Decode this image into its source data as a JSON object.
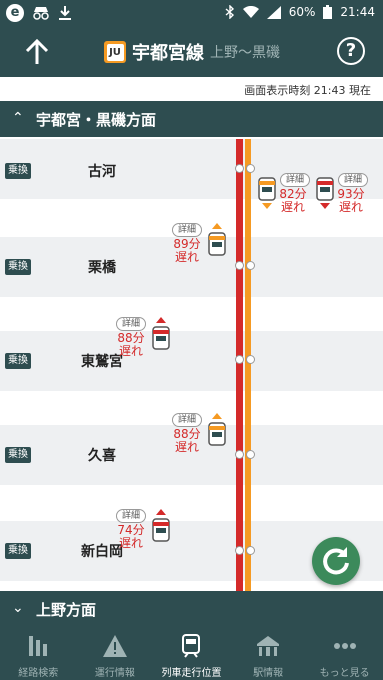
{
  "status_bar": {
    "battery": "60%",
    "time": "21:44"
  },
  "header": {
    "line_badge": "JU",
    "line_name": "宇都宮線",
    "range": "上野〜黒磯"
  },
  "display_time": "画面表示時刻 21:43 現在",
  "sections": {
    "outbound": "宇都宮・黒磯方面",
    "inbound": "上野方面"
  },
  "transfer_label": "乗換",
  "detail_label": "詳細",
  "stations": [
    {
      "name": "古河"
    },
    {
      "name": "栗橋"
    },
    {
      "name": "東鷲宮"
    },
    {
      "name": "久喜"
    },
    {
      "name": "新白岡"
    }
  ],
  "trains": [
    {
      "delay": "82分\n遅れ",
      "direction": "down",
      "color": "#f59a23"
    },
    {
      "delay": "93分\n遅れ",
      "direction": "down",
      "color": "#d42a2a"
    },
    {
      "delay": "89分\n遅れ",
      "direction": "up",
      "color": "#f59a23"
    },
    {
      "delay": "88分\n遅れ",
      "direction": "up",
      "color": "#d42a2a"
    },
    {
      "delay": "88分\n遅れ",
      "direction": "up",
      "color": "#f59a23"
    },
    {
      "delay": "74分\n遅れ",
      "direction": "up",
      "color": "#d42a2a"
    }
  ],
  "bottom_nav": [
    {
      "label": "経路検索",
      "icon": "route-search-icon"
    },
    {
      "label": "運行情報",
      "icon": "warning-icon"
    },
    {
      "label": "列車走行位置",
      "icon": "train-icon",
      "active": true
    },
    {
      "label": "駅情報",
      "icon": "station-icon"
    },
    {
      "label": "もっと見る",
      "icon": "more-icon"
    }
  ],
  "colors": {
    "header": "#2e4d50",
    "jr_red": "#d42a2a",
    "jr_orange": "#f59a23",
    "refresh": "#3c8a5b"
  }
}
